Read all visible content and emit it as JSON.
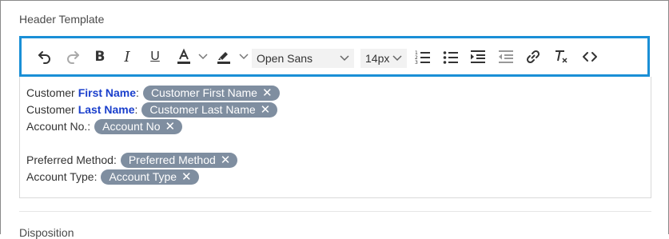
{
  "section": {
    "title": "Header Template"
  },
  "toolbar": {
    "font_family": "Open Sans",
    "font_size": "14px",
    "text_color": "#333333",
    "highlight_color": "#333333",
    "icons": [
      "undo-icon",
      "redo-icon",
      "bold-icon",
      "italic-icon",
      "underline-icon",
      "text-color-icon",
      "highlight-icon",
      "ordered-list-icon",
      "bullet-list-icon",
      "indent-icon",
      "outdent-icon",
      "link-icon",
      "clear-format-icon",
      "code-icon"
    ],
    "bold_label": "B",
    "italic_label": "I",
    "underline_label": "U"
  },
  "editor": {
    "lines": [
      {
        "prefix": "Customer",
        "strong": "First Name",
        "suffix": ":",
        "chip": "Customer First Name"
      },
      {
        "prefix": "Customer",
        "strong": "Last Name",
        "suffix": ":",
        "chip": "Customer Last Name"
      },
      {
        "prefix": "Account No.:",
        "chip": "Account No"
      },
      {
        "prefix": "Preferred Method:",
        "chip": "Preferred Method"
      },
      {
        "prefix": "Account Type:",
        "chip": "Account Type"
      }
    ],
    "chip_remove_glyph": "✕"
  },
  "next_section": {
    "title": "Disposition"
  },
  "colors": {
    "accent": "#1a8fd6",
    "chip": "#7f8ea0",
    "strong_text": "#1a3fcc"
  }
}
